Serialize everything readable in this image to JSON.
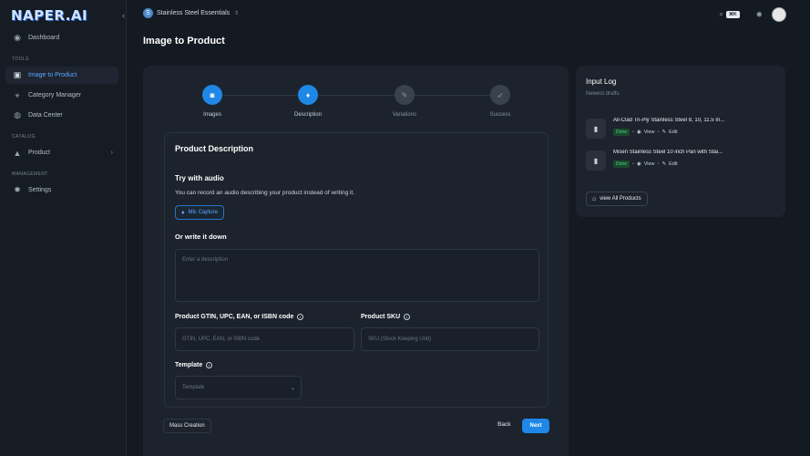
{
  "app": {
    "logo": "NAPER.AI",
    "workspace": {
      "initial": "S",
      "name": "Stainless Steel Essentials"
    },
    "search_shortcut": "⌘K"
  },
  "sidebar": {
    "items": [
      {
        "label": "Dashboard",
        "icon": "dashboard-icon"
      },
      {
        "label": "Image to Product",
        "icon": "image-product-icon",
        "active": true
      },
      {
        "label": "Category Manager",
        "icon": "category-icon"
      },
      {
        "label": "Data Center",
        "icon": "database-icon"
      },
      {
        "label": "Product",
        "icon": "product-icon"
      },
      {
        "label": "Settings",
        "icon": "gear-icon"
      }
    ],
    "sections": {
      "tools": "TOOLS",
      "catalog": "CATALOG",
      "management": "MANAGEMENT"
    }
  },
  "page": {
    "title": "Image to Product"
  },
  "stepper": {
    "steps": [
      {
        "label": "Images",
        "state": "done"
      },
      {
        "label": "Description",
        "state": "current"
      },
      {
        "label": "Variations",
        "state": "todo"
      },
      {
        "label": "Success",
        "state": "todo"
      }
    ]
  },
  "form": {
    "section_title": "Product Description",
    "audio_title": "Try with audio",
    "audio_text": "You can record an audio describing your product instead of writing it.",
    "mic_label": "Mic Capture",
    "write_title": "Or write it down",
    "description_placeholder": "Enter a description",
    "gtin_label": "Product GTIN, UPC, EAN, or ISBN code",
    "gtin_placeholder": "GTIN, UPC, EAN, or ISBN code",
    "sku_label": "Product SKU",
    "sku_placeholder": "SKU (Stock Keeping Unit)",
    "template_label": "Template",
    "template_placeholder": "Template"
  },
  "actions": {
    "mass_creation": "Mass Creation",
    "back": "Back",
    "next": "Next"
  },
  "input_log": {
    "title": "Input Log",
    "subtitle": "Newest drafts",
    "items": [
      {
        "name": "All-Clad Tri-Ply Stainless Steel 8, 10, 11.5 In...",
        "status": "Done",
        "view": "View",
        "edit": "Edit"
      },
      {
        "name": "Misen Stainless Steel 10 inch Pan with Stai...",
        "status": "Done",
        "view": "View",
        "edit": "Edit"
      }
    ],
    "view_all": "view All Products"
  }
}
